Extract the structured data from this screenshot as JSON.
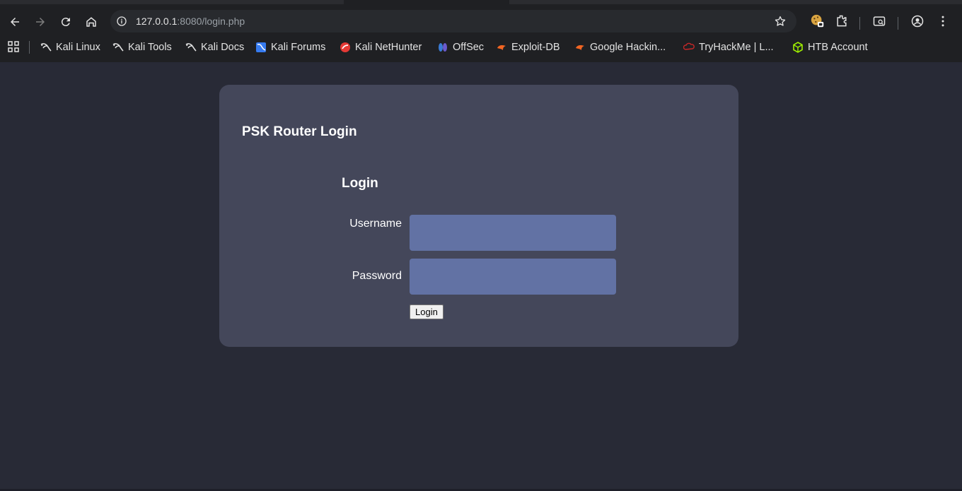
{
  "browser": {
    "url_host": "127.0.0.1",
    "url_path": ":8080/login.php",
    "bookmarks": [
      {
        "label": "Kali Linux",
        "icon": "kali-dragon-icon"
      },
      {
        "label": "Kali Tools",
        "icon": "kali-dragon-icon"
      },
      {
        "label": "Kali Docs",
        "icon": "kali-dragon-icon"
      },
      {
        "label": "Kali Forums",
        "icon": "kali-forums-icon"
      },
      {
        "label": "Kali NetHunter",
        "icon": "nethunter-icon"
      },
      {
        "label": "OffSec",
        "icon": "offsec-icon"
      },
      {
        "label": "Exploit-DB",
        "icon": "exploitdb-icon"
      },
      {
        "label": "Google Hackin...",
        "icon": "exploitdb-icon"
      },
      {
        "label": "TryHackMe | L...",
        "icon": "tryhackme-icon"
      },
      {
        "label": "HTB Account",
        "icon": "htb-icon"
      }
    ]
  },
  "page": {
    "title": "PSK Router Login",
    "form": {
      "heading": "Login",
      "username_label": "Username",
      "username_value": "",
      "password_label": "Password",
      "password_value": "",
      "submit_label": "Login"
    }
  },
  "colors": {
    "page_bg": "#282a36",
    "card_bg": "#44475a",
    "input_bg": "#6272a4"
  }
}
